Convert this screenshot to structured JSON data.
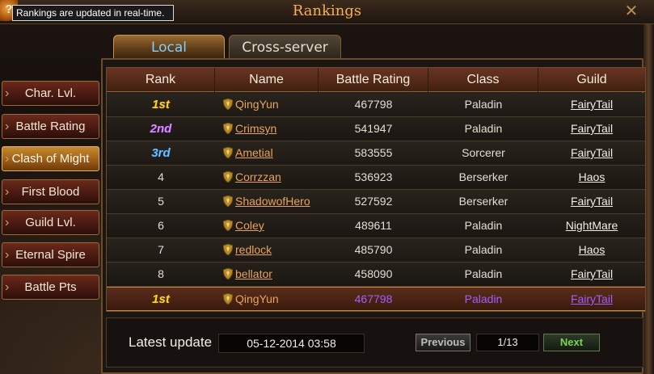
{
  "window": {
    "title": "Rankings",
    "tooltip": "Rankings are updated in real-time.",
    "help_glyph": "?",
    "close_glyph": "✕"
  },
  "tabs": [
    {
      "label": "Local",
      "active": true
    },
    {
      "label": "Cross-server",
      "active": false
    }
  ],
  "sidebar": {
    "items": [
      {
        "label": "Char. Lvl.",
        "active": false
      },
      {
        "label": "Battle Rating",
        "active": false
      },
      {
        "label": "Clash of Might",
        "active": true
      },
      {
        "label": "First Blood",
        "active": false
      },
      {
        "label": "Guild Lvl.",
        "active": false
      },
      {
        "label": "Eternal Spire",
        "active": false
      },
      {
        "label": "Battle Pts",
        "active": false
      }
    ]
  },
  "table": {
    "columns": [
      "Rank",
      "Name",
      "Battle Rating",
      "Class",
      "Guild"
    ],
    "rows": [
      {
        "rank": "1st",
        "name": "QingYun",
        "rating": "467798",
        "class": "Paladin",
        "guild": "FairyTail"
      },
      {
        "rank": "2nd",
        "name": "Crimsyn",
        "rating": "541947",
        "class": "Paladin",
        "guild": "FairyTail"
      },
      {
        "rank": "3rd",
        "name": "Ametial",
        "rating": "583555",
        "class": "Sorcerer",
        "guild": "FairyTail"
      },
      {
        "rank": "4",
        "name": "Corrzzan",
        "rating": "536923",
        "class": "Berserker",
        "guild": "Haos"
      },
      {
        "rank": "5",
        "name": "ShadowofHero",
        "rating": "527592",
        "class": "Berserker",
        "guild": "FairyTail"
      },
      {
        "rank": "6",
        "name": "Coley",
        "rating": "489611",
        "class": "Paladin",
        "guild": "NightMare"
      },
      {
        "rank": "7",
        "name": "redlock",
        "rating": "485790",
        "class": "Paladin",
        "guild": "Haos"
      },
      {
        "rank": "8",
        "name": "bellator",
        "rating": "458090",
        "class": "Paladin",
        "guild": "FairyTail"
      }
    ],
    "self_row": {
      "rank": "1st",
      "name": "QingYun",
      "rating": "467798",
      "class": "Paladin",
      "guild": "FairyTail"
    }
  },
  "footer": {
    "latest_update_label": "Latest update",
    "latest_update_value": "05-12-2014 03:58",
    "previous_label": "Previous",
    "page": "1/13",
    "next_label": "Next"
  },
  "colors": {
    "rank_1st": "#ffd23a",
    "rank_2nd": "#d98cff",
    "rank_3rd": "#6fbfff",
    "self_highlight": "#a65cff",
    "next_button": "#7ad35a"
  }
}
